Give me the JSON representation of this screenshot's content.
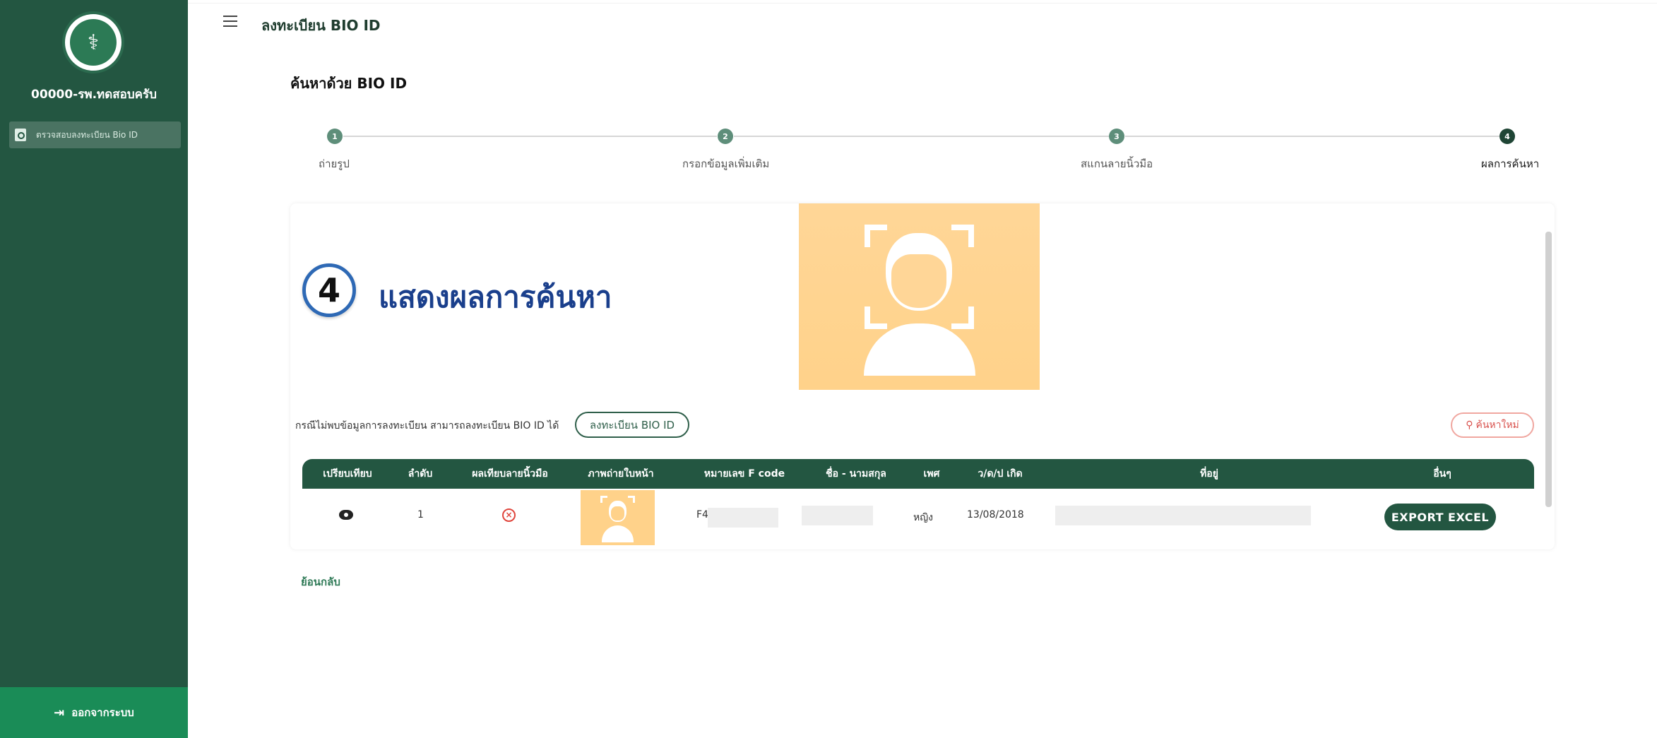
{
  "sidebar": {
    "logo_icon": "ministry-of-public-health-seal",
    "org_name": "00000-รพ.ทดสอบครับ",
    "menu_item_label": "ตรวจสอบลงทะเบียน Bio ID",
    "logout_label": "ออกจากระบบ",
    "logout_icon": "logout-icon"
  },
  "header": {
    "title": "ลงทะเบียน BIO ID"
  },
  "page": {
    "title": "ค้นหาด้วย BIO ID"
  },
  "stepper": {
    "steps": [
      {
        "number": "1",
        "label": "ถ่ายรูป"
      },
      {
        "number": "2",
        "label": "กรอกข้อมูลเพิ่มเติม"
      },
      {
        "number": "3",
        "label": "สแกนลายนิ้วมือ"
      },
      {
        "number": "4",
        "label": "ผลการค้นหา"
      }
    ],
    "active_step": 4
  },
  "overlay": {
    "step_number": "4",
    "heading": "แสดงผลการค้นหา"
  },
  "results": {
    "notice": "กรณีไม่พบข้อมูลการลงทะเบียน สามารถลงทะเบียน BIO ID ได้",
    "register_button": "ลงทะเบียน BIO ID",
    "new_search_button": "ค้นหาใหม่",
    "columns": [
      "เปรียบเทียบ",
      "ลำดับ",
      "ผลเทียบลายนิ้วมือ",
      "ภาพถ่ายใบหน้า",
      "หมายเลข F code",
      "ชื่อ - นามสกุล",
      "เพศ",
      "ว/ด/ป เกิด",
      "ที่อยู่",
      "อื่นๆ"
    ],
    "rows": [
      {
        "index": "1",
        "fcode": "F4",
        "gender": "หญิง",
        "birthdate": "13/08/2018",
        "action": "EXPORT EXCEL"
      }
    ]
  },
  "footer": {
    "back_label": "ย้อนกลับ"
  },
  "colors": {
    "sidebar": "#235641",
    "accent_badge": "#2e69b5",
    "heading_blue": "#1a3f8c",
    "photo_bg": "#ffd28a",
    "logout_bg": "#1a8c57"
  }
}
